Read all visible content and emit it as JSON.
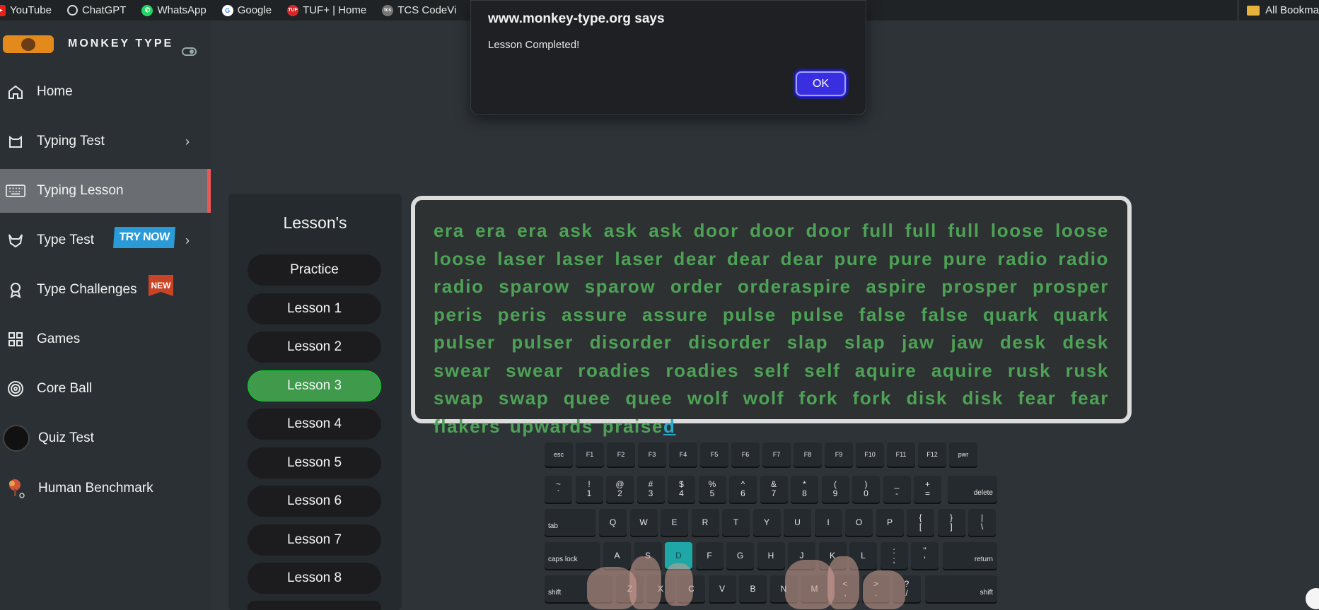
{
  "bookmarks": {
    "items": [
      {
        "label": "YouTube",
        "icon": "youtube-icon",
        "color": "#e62117"
      },
      {
        "label": "ChatGPT",
        "icon": "chatgpt-icon",
        "color": "#333333"
      },
      {
        "label": "WhatsApp",
        "icon": "whatsapp-icon",
        "color": "#25d366"
      },
      {
        "label": "Google",
        "icon": "google-icon",
        "color": "#4285f4"
      },
      {
        "label": "TUF+ | Home",
        "icon": "tuf-icon",
        "color": "#d62828"
      },
      {
        "label": "TCS CodeVi",
        "icon": "tcs-icon",
        "color": "#555555"
      }
    ],
    "all_bookmarks": "All Bookma"
  },
  "sidebar": {
    "brand": "MONKEY TYPE",
    "items": [
      {
        "label": "Home",
        "icon": "home-icon"
      },
      {
        "label": "Typing Test",
        "icon": "cat-icon",
        "chevron": true
      },
      {
        "label": "Typing Lesson",
        "icon": "keyboard-icon",
        "active": true
      },
      {
        "label": "Type Test",
        "icon": "fox-icon",
        "chevron": true,
        "badge": "TRY NOW"
      },
      {
        "label": "Type Challenges",
        "icon": "award-icon",
        "badge": "NEW"
      },
      {
        "label": "Games",
        "icon": "grid-icon"
      },
      {
        "label": "Core Ball",
        "icon": "target-icon"
      },
      {
        "label": "Quiz Test",
        "icon": "quiz-avatar-icon"
      },
      {
        "label": "Human Benchmark",
        "icon": "brain-tree-icon"
      }
    ]
  },
  "lessons": {
    "title": "Lesson's",
    "buttons": [
      "Practice",
      "Lesson 1",
      "Lesson 2",
      "Lesson 3",
      "Lesson 4",
      "Lesson 5",
      "Lesson 6",
      "Lesson 7",
      "Lesson 8"
    ],
    "active": "Lesson 3"
  },
  "lesson_text": {
    "typed": "era era era ask ask ask door door door full full full loose loose loose laser laser laser dear dear dear pure pure pure radio radio radio sparow sparow order orderaspire aspire prosper prosper peris peris assure assure pulse pulse false false quark quark pulser pulser disorder disorder slap slap jaw jaw desk desk swear swear roadies roadies self self aquire aquire rusk rusk swap swap quee quee wolf wolf fork fork disk disk fear fear flakers upwards praise",
    "current_char": "d"
  },
  "keyboard": {
    "row0": [
      "esc",
      "F1",
      "F2",
      "F3",
      "F4",
      "F5",
      "F6",
      "F7",
      "F8",
      "F9",
      "F10",
      "F11",
      "F12",
      "pwr"
    ],
    "row1": [
      [
        "~",
        "`"
      ],
      [
        "!",
        "1"
      ],
      [
        "@",
        "2"
      ],
      [
        "#",
        "3"
      ],
      [
        "$",
        "4"
      ],
      [
        "%",
        "5"
      ],
      [
        "^",
        "6"
      ],
      [
        "&",
        "7"
      ],
      [
        "*",
        "8"
      ],
      [
        "(",
        "9"
      ],
      [
        ")",
        "0"
      ],
      [
        "_",
        "-"
      ],
      [
        "+",
        "="
      ]
    ],
    "row1_end": "delete",
    "row2_start": "tab",
    "row2": [
      "Q",
      "W",
      "E",
      "R",
      "T",
      "Y",
      "U",
      "I",
      "O",
      "P",
      [
        "{",
        "["
      ],
      [
        "}",
        "]"
      ],
      [
        "|",
        "\\"
      ]
    ],
    "row3_start": "caps lock",
    "row3": [
      "A",
      "S",
      "D",
      "F",
      "G",
      "H",
      "J",
      "K",
      "L",
      [
        ":",
        ";"
      ],
      [
        "\"",
        "'"
      ]
    ],
    "row3_end": "return",
    "row4_start": "shift",
    "row4": [
      "Z",
      "X",
      "C",
      "V",
      "B",
      "N",
      "M",
      [
        "<",
        ","
      ],
      [
        ">",
        "."
      ],
      [
        "?",
        "/"
      ]
    ],
    "row4_end": "shift",
    "highlighted": "D"
  },
  "dialog": {
    "title": "www.monkey-type.org says",
    "message": "Lesson Completed!",
    "ok_label": "OK"
  }
}
